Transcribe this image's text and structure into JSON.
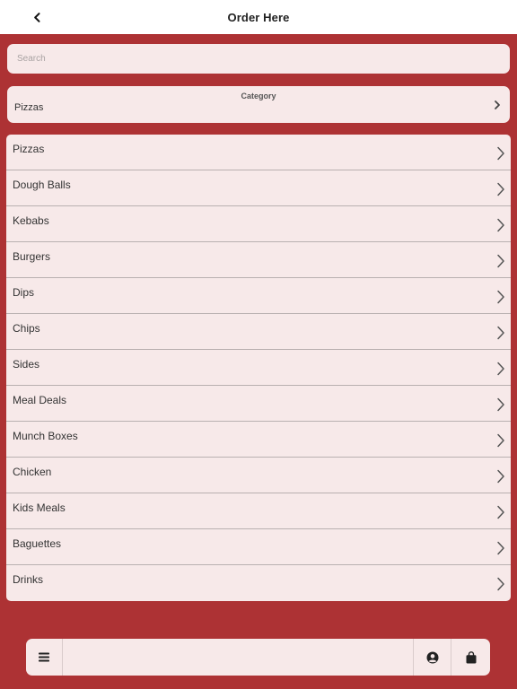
{
  "header": {
    "title": "Order Here",
    "back_icon": "chevron-left-icon"
  },
  "search": {
    "placeholder": "Search",
    "value": ""
  },
  "category": {
    "heading": "Category",
    "selected": "Pizzas",
    "icon": "chevron-right-icon"
  },
  "menu_items": [
    {
      "label": "Pizzas"
    },
    {
      "label": "Dough Balls"
    },
    {
      "label": "Kebabs"
    },
    {
      "label": "Burgers"
    },
    {
      "label": "Dips"
    },
    {
      "label": "Chips"
    },
    {
      "label": "Sides"
    },
    {
      "label": "Meal Deals"
    },
    {
      "label": "Munch Boxes"
    },
    {
      "label": "Chicken"
    },
    {
      "label": "Kids Meals"
    },
    {
      "label": "Baguettes"
    },
    {
      "label": "Drinks"
    }
  ],
  "toolbar": {
    "menu_icon": "hamburger-menu-icon",
    "account_icon": "user-account-icon",
    "bag_icon": "shopping-bag-icon"
  },
  "colors": {
    "background": "#ad3234",
    "surface": "#f7e9e9",
    "header": "#ffffff",
    "text": "#333333"
  }
}
